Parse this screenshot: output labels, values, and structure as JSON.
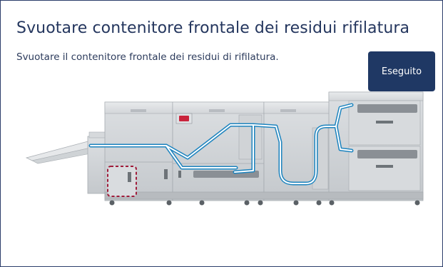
{
  "dialog": {
    "title": "Svuotare contenitore frontale dei residui rifilatura",
    "instruction": "Svuotare il contenitore frontale dei residui di rifilatura.",
    "done_label": "Eseguito"
  },
  "illustration": {
    "icon": "printer-system-illustration",
    "highlight": "front-trim-waste-container",
    "highlight_color": "#a01c3a",
    "paper_path_color": "#2a9fd6"
  }
}
